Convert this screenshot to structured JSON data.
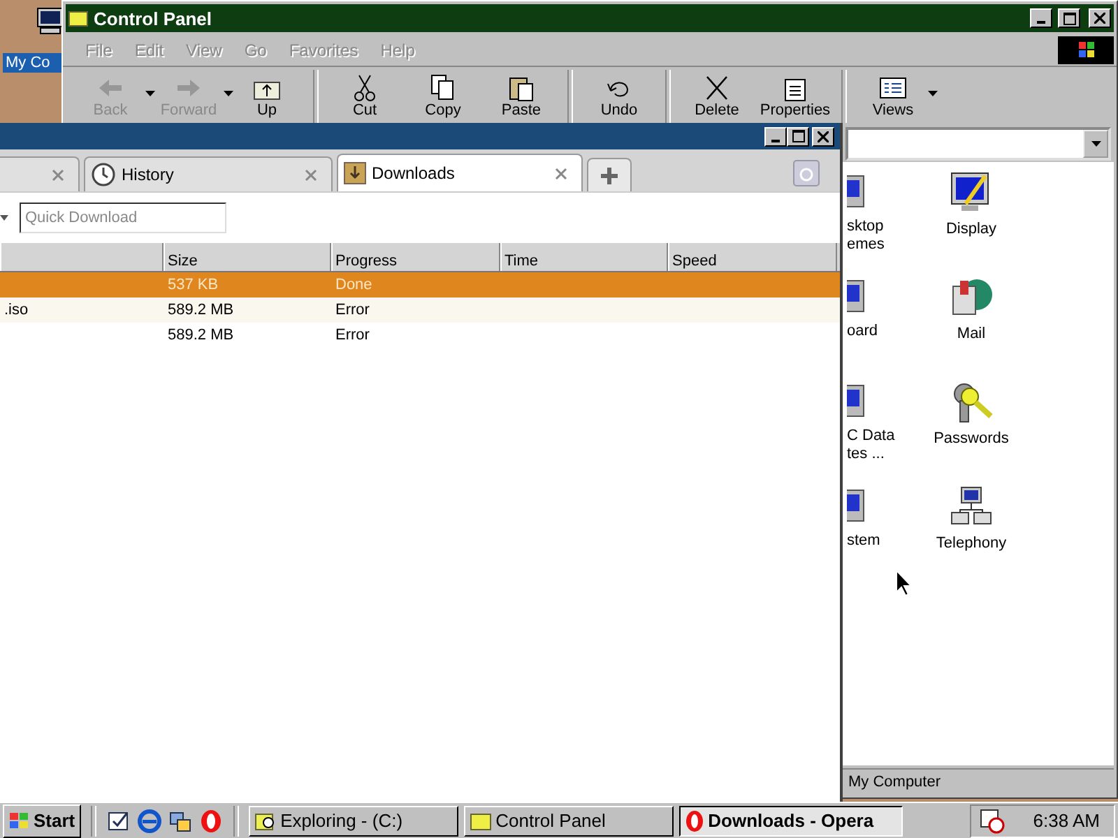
{
  "desktop": {
    "icon_label": "My Co"
  },
  "control_panel": {
    "title": "Control Panel",
    "menu": [
      {
        "label": "File",
        "disabled": true
      },
      {
        "label": "Edit",
        "disabled": true
      },
      {
        "label": "View",
        "disabled": true
      },
      {
        "label": "Go",
        "disabled": true
      },
      {
        "label": "Favorites",
        "disabled": true
      },
      {
        "label": "Help",
        "disabled": true
      }
    ],
    "toolbar_groups": [
      [
        {
          "label": "Back",
          "disabled": true,
          "dropdown": true
        },
        {
          "label": "Forward",
          "disabled": true,
          "dropdown": true
        },
        {
          "label": "Up",
          "disabled": false,
          "dropdown": false
        }
      ],
      [
        {
          "label": "Cut",
          "disabled": false,
          "dropdown": false
        },
        {
          "label": "Copy",
          "disabled": false,
          "dropdown": false
        },
        {
          "label": "Paste",
          "disabled": false,
          "dropdown": false
        }
      ],
      [
        {
          "label": "Undo",
          "disabled": false,
          "dropdown": false
        }
      ],
      [
        {
          "label": "Delete",
          "disabled": false,
          "dropdown": false
        },
        {
          "label": "Properties",
          "disabled": false,
          "dropdown": false
        }
      ],
      [
        {
          "label": "Views",
          "disabled": false,
          "dropdown": true
        }
      ]
    ],
    "icons_left": [
      {
        "lines": [
          "sktop",
          "emes"
        ]
      },
      {
        "lines": [
          "oard"
        ]
      },
      {
        "lines": [
          "C Data",
          "tes ..."
        ]
      },
      {
        "lines": [
          "stem"
        ]
      }
    ],
    "icons_right": [
      {
        "lines": [
          "Display"
        ]
      },
      {
        "lines": [
          "Mail"
        ]
      },
      {
        "lines": [
          "Passwords"
        ]
      },
      {
        "lines": [
          "Telephony"
        ]
      }
    ],
    "status": "My Computer"
  },
  "opera": {
    "tabs": [
      {
        "selected": false
      },
      {
        "label": "History",
        "selected": false
      },
      {
        "label": "Downloads",
        "selected": true
      }
    ],
    "quick_download": {
      "placeholder": "Quick Download"
    },
    "columns": [
      "Size",
      "Progress",
      "Time",
      "Speed"
    ],
    "rows": [
      {
        "size": "537 KB",
        "progress": "Done",
        "selected": true
      },
      {
        "name": ".iso",
        "size": "589.2 MB",
        "progress": "Error",
        "selected": false
      },
      {
        "size": "589.2 MB",
        "progress": "Error",
        "selected": false
      }
    ]
  },
  "taskbar": {
    "start": "Start",
    "tasks": [
      {
        "label": "Exploring -  (C:)",
        "selected": false
      },
      {
        "label": "Control Panel",
        "selected": false
      },
      {
        "label": "Downloads - Opera",
        "selected": true
      }
    ],
    "clock": "6:38 AM"
  }
}
